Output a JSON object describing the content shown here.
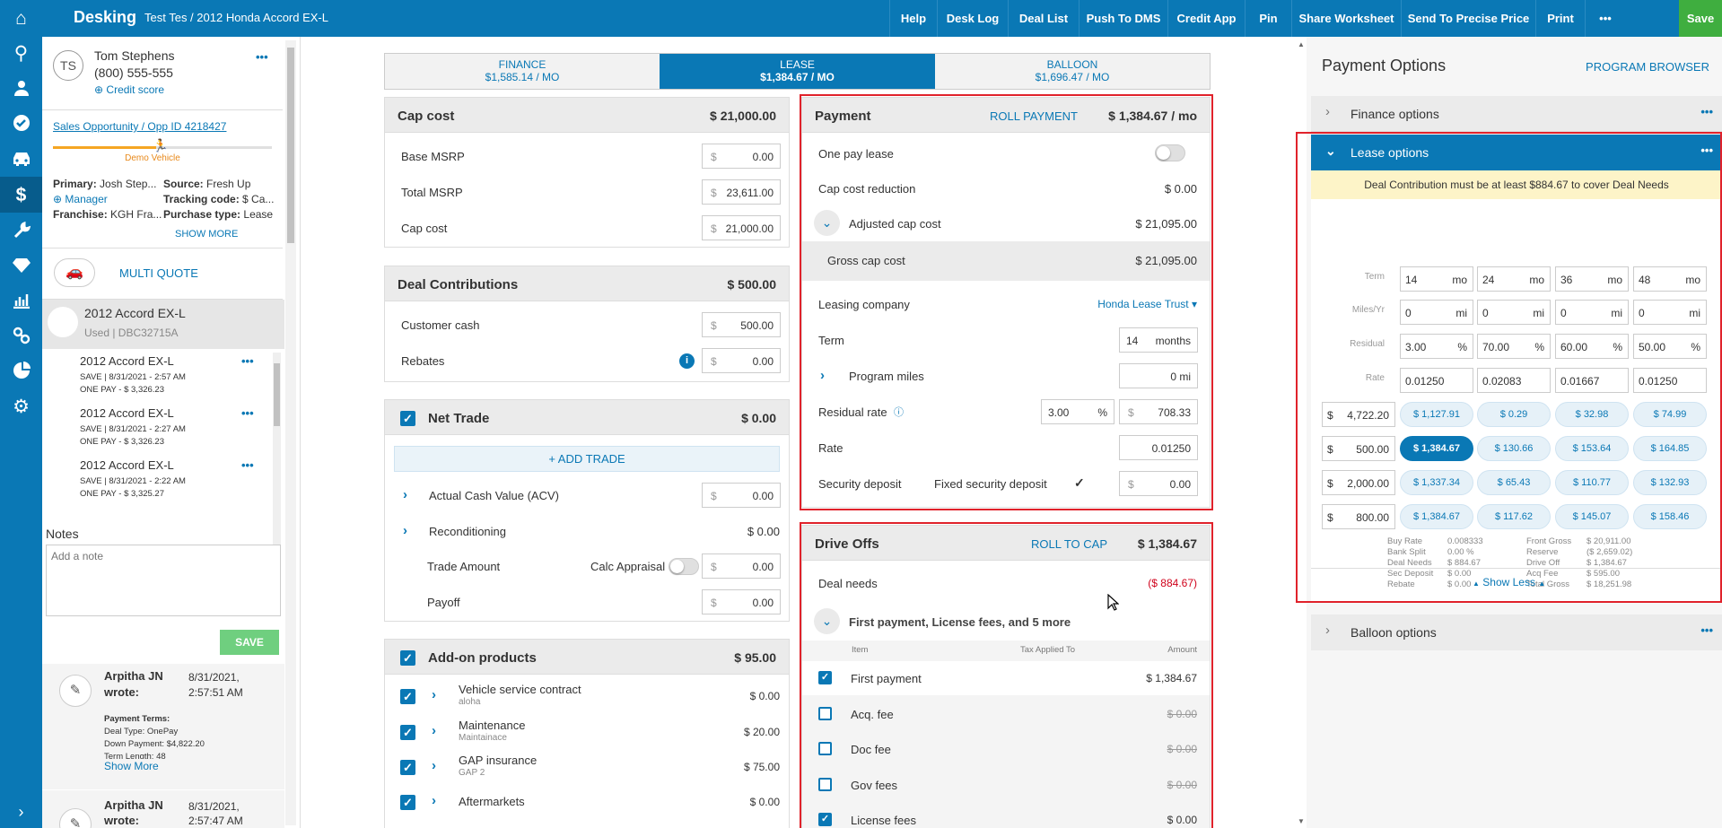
{
  "rail": {
    "icons": [
      "home-icon",
      "search-icon",
      "user-icon",
      "check-circle-icon",
      "car-icon",
      "dollar-icon",
      "wrench-icon",
      "diamond-icon",
      "bar-chart-icon",
      "link-icon",
      "pie-chart-icon",
      "gear-icon",
      "expand-icon"
    ]
  },
  "topbar": {
    "brand": "Desking",
    "deal": "Test Tes / 2012 Honda Accord EX-L",
    "buttons": [
      "Help",
      "Desk Log",
      "Deal List",
      "Push To DMS",
      "Credit App",
      "Pin",
      "Share Worksheet",
      "Send To Precise Price",
      "Print",
      "•••",
      "Save"
    ]
  },
  "customer": {
    "initials": "TS",
    "name": "Tom Stephens",
    "phone": "(800) 555-555",
    "credit_link": "Credit score",
    "menu": "•••",
    "opportunity": "Sales Opportunity / Opp ID 4218427",
    "progress_label": "Demo Vehicle",
    "progress": 0.47,
    "primary_label": "Primary:",
    "primary_value": "Josh Step...",
    "source_label": "Source:",
    "source_value": "Fresh Up",
    "manager": "Manager",
    "tracking_label": "Tracking code:",
    "tracking_value": "$ Ca...",
    "franchise_label": "Franchise:",
    "franchise_value": "KGH Fra...",
    "purchase_label": "Purchase type:",
    "purchase_value": "Lease",
    "show_more": "SHOW MORE"
  },
  "multi_quote": "MULTI QUOTE",
  "vehicle": {
    "name": "2012 Accord EX-L",
    "sub": "Used | DBC32715A"
  },
  "saved": [
    {
      "name": "2012 Accord EX-L",
      "line1": "SAVE | 8/31/2021 - 2:57 AM",
      "line2": "ONE PAY - $ 3,326.23"
    },
    {
      "name": "2012 Accord EX-L",
      "line1": "SAVE | 8/31/2021 - 2:27 AM",
      "line2": "ONE PAY - $ 3,326.23"
    },
    {
      "name": "2012 Accord EX-L",
      "line1": "SAVE | 8/31/2021 - 2:22 AM",
      "line2": "ONE PAY - $ 3,325.27"
    }
  ],
  "notes": {
    "title": "Notes",
    "placeholder": "Add a note",
    "save": "SAVE",
    "items": [
      {
        "author": "Arpitha JN",
        "wrote": "wrote:",
        "date": "8/31/2021,",
        "time": "2:57:51 AM",
        "terms_title": "Payment Terms:",
        "l1": "Deal Type: OnePay",
        "l2": "Down Payment: $4,822.20",
        "l3": "Term Length: 48",
        "more": "Show More"
      },
      {
        "author": "Arpitha JN",
        "wrote": "wrote:",
        "date": "8/31/2021,",
        "time": "2:57:47 AM"
      }
    ]
  },
  "tabs": [
    {
      "label": "FINANCE",
      "value": "$1,585.14 / MO"
    },
    {
      "label": "LEASE",
      "value": "$1,384.67 / MO"
    },
    {
      "label": "BALLOON",
      "value": "$1,696.47 / MO"
    }
  ],
  "cap_cost": {
    "title": "Cap cost",
    "total": "$ 21,000.00",
    "currency": "$",
    "rows": [
      {
        "label": "Base MSRP",
        "value": "0.00"
      },
      {
        "label": "Total MSRP",
        "value": "23,611.00"
      },
      {
        "label": "Cap cost",
        "value": "21,000.00"
      }
    ]
  },
  "contributions": {
    "title": "Deal Contributions",
    "total": "$ 500.00",
    "rows": [
      {
        "label": "Customer cash",
        "value": "500.00"
      },
      {
        "label": "Rebates",
        "value": "0.00"
      }
    ]
  },
  "trade": {
    "title": "Net Trade",
    "total": "$ 0.00",
    "add": "+ ADD TRADE",
    "acv": "Actual Cash Value (ACV)",
    "acv_value": "0.00",
    "recon": "Reconditioning",
    "recon_value": "$ 0.00",
    "amount": "Trade Amount",
    "calc": "Calc Appraisal",
    "amount_value": "0.00",
    "payoff": "Payoff",
    "payoff_value": "0.00"
  },
  "addons": {
    "title": "Add-on products",
    "total": "$ 95.00",
    "items": [
      {
        "name": "Vehicle service contract",
        "sub": "aloha",
        "value": "$ 0.00"
      },
      {
        "name": "Maintenance",
        "sub": "Maintainace",
        "value": "$ 20.00"
      },
      {
        "name": "GAP insurance",
        "sub": "GAP 2",
        "value": "$ 75.00"
      },
      {
        "name": "Aftermarkets",
        "sub": "",
        "value": "$ 0.00"
      }
    ]
  },
  "payment": {
    "title": "Payment",
    "roll": "ROLL PAYMENT",
    "total": "$ 1,384.67 / mo",
    "one_pay": "One pay lease",
    "ccr": "Cap cost reduction",
    "ccr_value": "$ 0.00",
    "adj": "Adjusted cap cost",
    "adj_value": "$ 21,095.00",
    "gross": "Gross cap cost",
    "gross_value": "$ 21,095.00",
    "company": "Leasing company",
    "company_value": "Honda Lease Trust",
    "term": "Term",
    "term_value": "14",
    "term_unit": "months",
    "miles": "Program miles",
    "miles_value": "0 mi",
    "residual": "Residual rate",
    "residual_pct": "3.00",
    "residual_amt": "708.33",
    "rate": "Rate",
    "rate_value": "0.01250",
    "deposit": "Security deposit",
    "fixed": "Fixed security deposit",
    "deposit_value": "0.00"
  },
  "driveoffs": {
    "title": "Drive Offs",
    "roll": "ROLL TO CAP",
    "total": "$ 1,384.67",
    "needs": "Deal needs",
    "needs_value": "($ 884.67)",
    "group": "First payment, License fees, and 5 more",
    "col_item": "Item",
    "col_tax": "Tax Applied To",
    "col_amount": "Amount",
    "items": [
      {
        "name": "First payment",
        "value": "$ 1,384.67",
        "checked": true
      },
      {
        "name": "Acq. fee",
        "value": "$ 0.00",
        "checked": false
      },
      {
        "name": "Doc fee",
        "value": "$ 0.00",
        "checked": false
      },
      {
        "name": "Gov fees",
        "value": "$ 0.00",
        "checked": false
      },
      {
        "name": "License fees",
        "value": "$ 0.00",
        "checked": true
      }
    ]
  },
  "options": {
    "title": "Payment Options",
    "browser": "PROGRAM BROWSER",
    "finance": "Finance options",
    "lease": "Lease options",
    "balloon": "Balloon options",
    "warning": "Deal Contribution must be at least $884.67 to cover Deal Needs",
    "labels": {
      "term": "Term",
      "miles": "Miles/Yr",
      "residual": "Residual",
      "rate": "Rate"
    },
    "terms": [
      "14",
      "24",
      "36",
      "48"
    ],
    "term_unit": "mo",
    "miles": [
      "0",
      "0",
      "0",
      "0"
    ],
    "miles_unit": "mi",
    "residuals": [
      "3.00",
      "70.00",
      "60.00",
      "50.00"
    ],
    "rates": [
      "0.01250",
      "0.02083",
      "0.01667",
      "0.01250"
    ],
    "grid": [
      {
        "down": "4,722.20",
        "cells": [
          "$ 1,127.91",
          "$ 0.29",
          "$ 32.98",
          "$ 74.99"
        ]
      },
      {
        "down": "500.00",
        "cells": [
          "$ 1,384.67",
          "$ 130.66",
          "$ 153.64",
          "$ 164.85"
        ]
      },
      {
        "down": "2,000.00",
        "cells": [
          "$ 1,337.34",
          "$ 65.43",
          "$ 110.77",
          "$ 132.93"
        ]
      },
      {
        "down": "800.00",
        "cells": [
          "$ 1,384.67",
          "$ 117.62",
          "$ 145.07",
          "$ 158.46"
        ]
      }
    ],
    "summary_left": [
      [
        "Buy Rate",
        "0.008333"
      ],
      [
        "Bank Split",
        "0.00 %"
      ],
      [
        "Deal Needs",
        "$ 884.67"
      ],
      [
        "Sec Deposit",
        "$ 0.00"
      ],
      [
        "Rebate",
        "$ 0.00"
      ]
    ],
    "summary_right": [
      [
        "Front Gross",
        "$ 20,911.00"
      ],
      [
        "Reserve",
        "($ 2,659.02)"
      ],
      [
        "Drive Off",
        "$ 1,384.67"
      ],
      [
        "Acq Fee",
        "$ 595.00"
      ],
      [
        "Total Gross",
        "$ 18,251.98"
      ]
    ],
    "show_less": "Show Less",
    "menu": "•••"
  }
}
